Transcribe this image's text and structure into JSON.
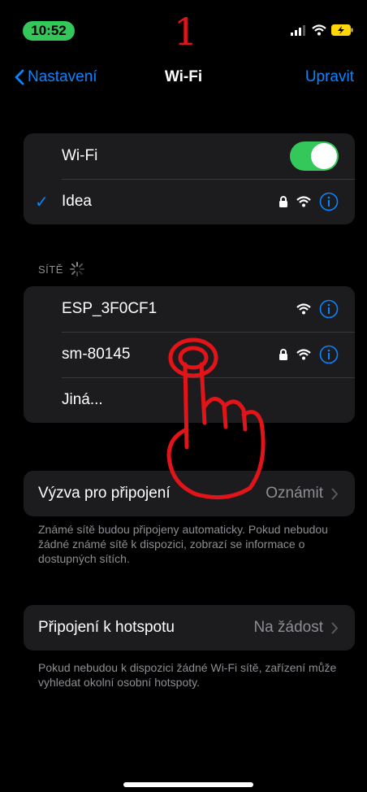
{
  "status": {
    "time": "10:52",
    "step_number": "1"
  },
  "nav": {
    "back_label": "Nastavení",
    "title": "Wi-Fi",
    "edit_label": "Upravit"
  },
  "current": {
    "wifi_label": "Wi-Fi",
    "wifi_enabled": true,
    "connected_network": "Idea"
  },
  "networks": {
    "header": "SÍTĚ",
    "items": [
      {
        "name": "ESP_3F0CF1",
        "locked": false
      },
      {
        "name": "sm-80145",
        "locked": true
      }
    ],
    "other_label": "Jiná..."
  },
  "ask_to_join": {
    "label": "Výzva pro připojení",
    "value": "Oznámit",
    "footer": "Známé sítě budou připojeny automaticky. Pokud nebudou žádné známé sítě k dispozici, zobrazí se informace o dostupných sítích."
  },
  "hotspot": {
    "label": "Připojení k hotspotu",
    "value": "Na žádost",
    "footer": "Pokud nebudou k dispozici žádné Wi-Fi sítě, zařízení může vyhledat okolní osobní hotspoty."
  },
  "colors": {
    "accent": "#0a84ff",
    "toggle_on": "#34c759",
    "annotation": "#e1141a"
  }
}
